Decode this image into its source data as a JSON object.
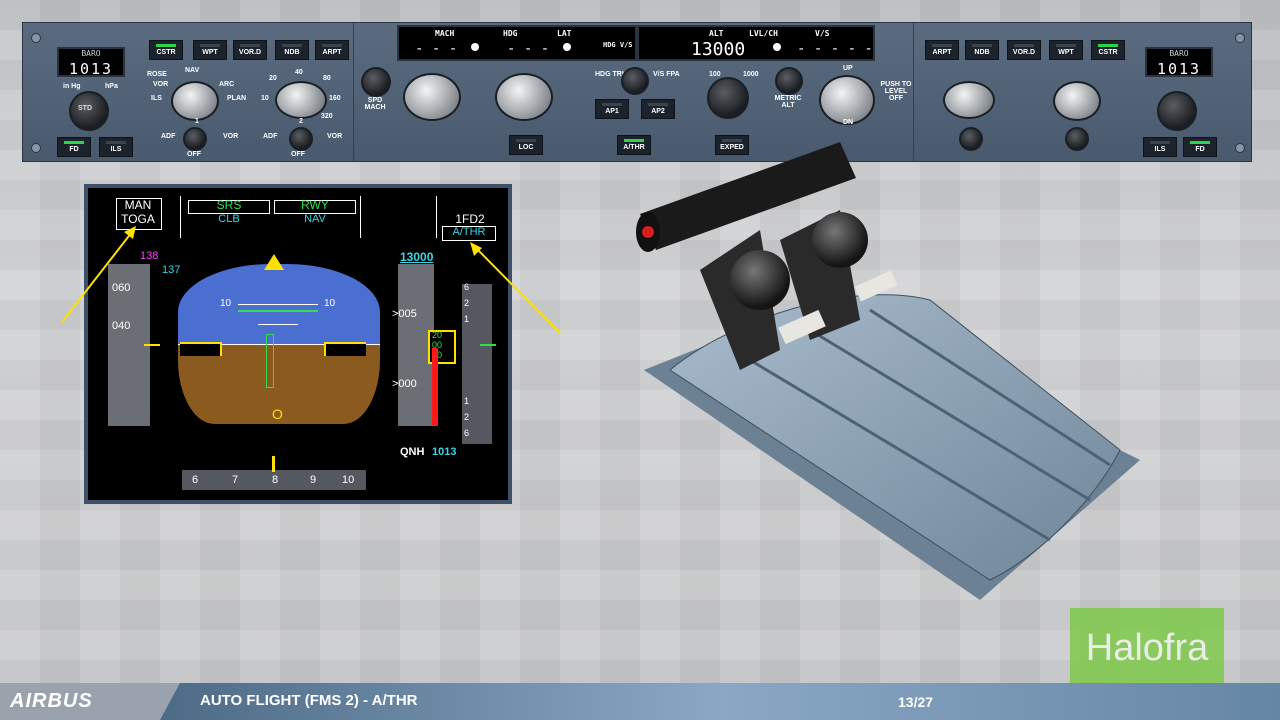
{
  "footer": {
    "brand": "AIRBUS",
    "title": "AUTO FLIGHT (FMS 2) - A/THR",
    "page": "13/27"
  },
  "watermark": "Halofra",
  "fcu": {
    "left_efis": {
      "baro_label": "BARO",
      "baro_value": "1013",
      "buttons": [
        "CSTR",
        "WPT",
        "VOR.D",
        "NDB",
        "ARPT"
      ],
      "mode_labels": [
        "ROSE",
        "NAV",
        "VOR",
        "ARC",
        "ILS",
        "PLAN"
      ],
      "range_labels": [
        "20",
        "40",
        "80",
        "10",
        "160",
        "320"
      ],
      "unit_labels": [
        "in Hg",
        "hPa"
      ],
      "std_label": "STD",
      "fd_label": "FD",
      "ils_label": "ILS",
      "adf1": "ADF",
      "vor1": "VOR",
      "num1": "1",
      "off1": "OFF",
      "adf2": "ADF",
      "vor2": "VOR",
      "num2": "2",
      "off2": "OFF"
    },
    "center": {
      "mach_label": "MACH",
      "hdg_label": "HDG",
      "lat_label": "LAT",
      "spd_display": "- - -",
      "hdg_display": "- - -",
      "hdg_vs_label": "HDG  V/S",
      "alt_label": "ALT",
      "lvlch_label": "LVL/CH",
      "vs_label": "V/S",
      "alt_display": "13000",
      "vs_display": "- - - - -",
      "spd_mach_btn": "SPD MACH",
      "hdg_trk": "HDG TRK",
      "vs_fpa": "V/S FPA",
      "ap1": "AP1",
      "ap2": "AP2",
      "athr": "A/THR",
      "loc": "LOC",
      "exped": "EXPED",
      "alt_100": "100",
      "alt_1000": "1000",
      "metric_alt": "METRIC ALT",
      "up": "UP",
      "dn": "DN",
      "push_level_off": "PUSH TO LEVEL OFF"
    },
    "right_efis": {
      "baro_label": "BARO",
      "baro_value": "1013",
      "buttons": [
        "ARPT",
        "NDB",
        "VOR.D",
        "WPT",
        "CSTR"
      ],
      "fd_label": "FD",
      "ils_label": "ILS"
    }
  },
  "pfd": {
    "fma": {
      "col1_line1": "MAN",
      "col1_line2": "TOGA",
      "col2_line1": "SRS",
      "col2_line2": "CLB",
      "col3_line1": "RWY",
      "col3_line2": "NAV",
      "col5_line1": "1FD2",
      "col5_line2": "A/THR"
    },
    "speed": {
      "target": "138",
      "v2": "137",
      "ticks": [
        "060",
        "040"
      ]
    },
    "altitude": {
      "target": "13000",
      "ticks": [
        ">005",
        ">000"
      ],
      "readout": [
        "20",
        "00",
        "80"
      ]
    },
    "vs_ticks": [
      "6",
      "2",
      "1",
      "1",
      "2",
      "6"
    ],
    "pitch": [
      "10",
      "10"
    ],
    "heading": [
      "6",
      "7",
      "8",
      "9",
      "10"
    ],
    "qnh_label": "QNH",
    "qnh_value": "1013",
    "zero": "O"
  },
  "colors": {
    "green": "#2fe04a",
    "cyan": "#37d6e6",
    "magenta": "#ff3cff",
    "yellow": "#ffe000",
    "sky": "#4a6fd1",
    "ground": "#8a5a1f"
  }
}
